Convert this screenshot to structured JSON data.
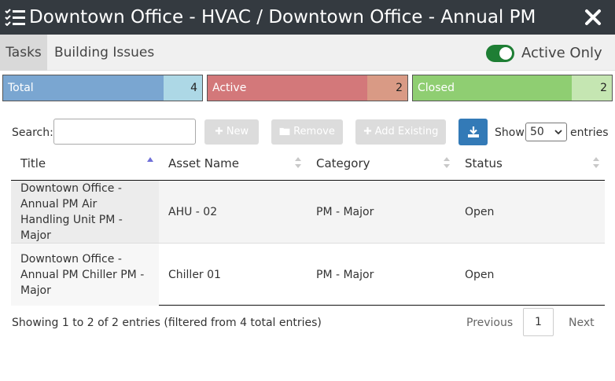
{
  "window": {
    "title": "Downtown Office - HVAC / Downtown Office - Annual PM",
    "icon": "task-list-icon",
    "close_icon": "close-icon"
  },
  "tabs": [
    {
      "label": "Tasks",
      "active": true
    },
    {
      "label": "Building Issues",
      "active": false
    }
  ],
  "filter": {
    "toggle_on": true,
    "label": "Active Only",
    "color": "#1e7e34"
  },
  "stats": {
    "total": {
      "label": "Total",
      "count": "4",
      "color": "#7aa6d1"
    },
    "active": {
      "label": "Active",
      "count": "2",
      "color": "#d3787a"
    },
    "closed": {
      "label": "Closed",
      "count": "2",
      "color": "#8fce72"
    }
  },
  "toolbar": {
    "search_label": "Search:",
    "search_value": "",
    "new_label": "New",
    "remove_label": "Remove",
    "add_existing_label": "Add Existing",
    "download_icon": "download-icon",
    "show_label": "Show",
    "entries_value": "50",
    "entries_label": "entries"
  },
  "table": {
    "columns": [
      "Title",
      "Asset Name",
      "Category",
      "Status"
    ],
    "rows": [
      {
        "title": "Downtown Office - Annual PM Air Handling Unit PM - Major",
        "asset": "AHU - 02",
        "category": "PM - Major",
        "status": "Open"
      },
      {
        "title": "Downtown Office - Annual PM Chiller PM - Major",
        "asset": "Chiller 01",
        "category": "PM - Major",
        "status": "Open"
      }
    ]
  },
  "footer": {
    "info": "Showing 1 to 2 of 2 entries (filtered from 4 total entries)",
    "previous": "Previous",
    "page": "1",
    "next": "Next"
  }
}
